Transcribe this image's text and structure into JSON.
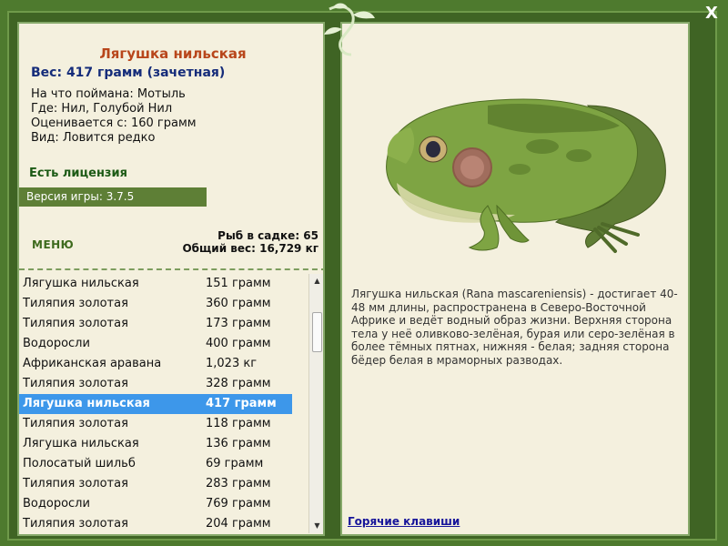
{
  "fish": {
    "name": "Лягушка нильская",
    "weight": "Вес: 417 грамм (зачетная)",
    "caught_on": "На что поймана: Мотыль",
    "where": "Где: Нил, Голубой Нил",
    "valued_from": "Оценивается с: 160 грамм",
    "kind": "Вид: Ловится редко"
  },
  "license": "Есть лицензия",
  "version": "Версия игры: 3.7.5",
  "menu_label": "МЕНЮ",
  "stats": {
    "fish_in_cage": "Рыб в садке: 65",
    "total_weight": "Общий вес: 16,729 кг"
  },
  "catch_list": [
    {
      "name": "Лягушка нильская",
      "weight": "151 грамм"
    },
    {
      "name": "Тиляпия золотая",
      "weight": "360 грамм"
    },
    {
      "name": "Тиляпия золотая",
      "weight": "173 грамм"
    },
    {
      "name": "Водоросли",
      "weight": "400 грамм"
    },
    {
      "name": "Африканская аравана",
      "weight": "1,023 кг"
    },
    {
      "name": "Тиляпия золотая",
      "weight": "328 грамм"
    },
    {
      "name": "Лягушка нильская",
      "weight": "417 грамм",
      "selected": true
    },
    {
      "name": "Тиляпия золотая",
      "weight": "118 грамм"
    },
    {
      "name": "Лягушка нильская",
      "weight": "136 грамм"
    },
    {
      "name": "Полосатый шильб",
      "weight": "69 грамм"
    },
    {
      "name": "Тиляпия золотая",
      "weight": "283 грамм"
    },
    {
      "name": "Водоросли",
      "weight": "769 грамм"
    },
    {
      "name": "Тиляпия золотая",
      "weight": "204 грамм"
    }
  ],
  "description": "Лягушка нильская (Rana mascareniensis) - достигает 40-48 мм длины, распространена в Северо-Восточной Африке и ведёт водный образ жизни. Верхняя сторона тела у неё оливково-зелёная, бурая или серо-зелёная в более тёмных пятнах, нижняя - белая; задняя сторона бёдер белая в мраморных разводах.",
  "hotkeys_label": "Горячие клавиши",
  "close_label": "X",
  "icons": {
    "close": "close-icon",
    "vine": "vine-ornament-icon",
    "frog": "frog-image"
  }
}
